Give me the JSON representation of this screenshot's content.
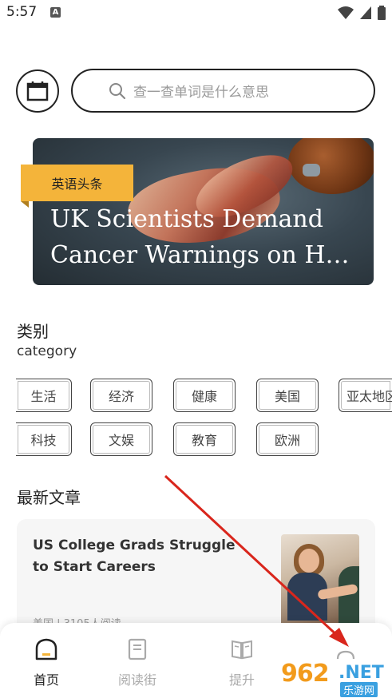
{
  "status_bar": {
    "time": "5:57",
    "notif_letter": "A"
  },
  "search": {
    "placeholder": "查一查单词是什么意思"
  },
  "banner": {
    "tag": "英语头条",
    "headline_line1": "UK Scientists Demand",
    "headline_line2": "Cancer Warnings on H…"
  },
  "category": {
    "title": "类别",
    "subtitle": "category",
    "chips_row1": [
      "生活",
      "经济",
      "健康",
      "美国",
      "亚太地区"
    ],
    "chips_row2": [
      "科技",
      "文娱",
      "教育",
      "欧洲"
    ]
  },
  "latest": {
    "title": "最新文章",
    "article": {
      "title": "US College Grads Struggle to Start Careers",
      "meta": "美国 | 3105人阅读"
    }
  },
  "nav": {
    "items": [
      {
        "label": "首页",
        "icon": "home-icon",
        "active": true
      },
      {
        "label": "阅读街",
        "icon": "book-icon",
        "active": false
      },
      {
        "label": "提升",
        "icon": "open-book-icon",
        "active": false
      },
      {
        "label": "",
        "icon": "profile-icon",
        "active": false
      }
    ]
  },
  "watermark": {
    "number": "962",
    "suffix": ".NET",
    "cn": "乐游网"
  },
  "colors": {
    "tag": "#f4b43a",
    "arrow": "#d9261c",
    "watermark_orange": "#f29b1c",
    "watermark_blue": "#3aa0e0"
  }
}
